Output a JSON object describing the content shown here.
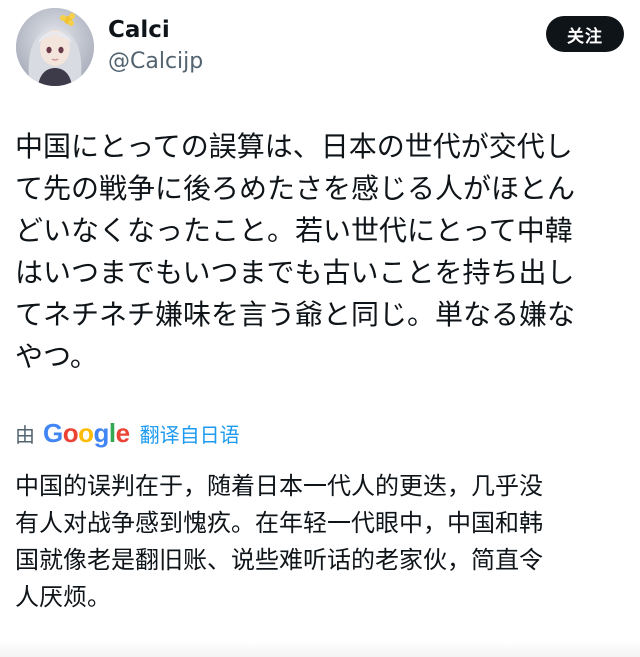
{
  "user": {
    "display_name": "Calci",
    "handle": "@Calcijp"
  },
  "actions": {
    "follow_label": "关注"
  },
  "tweet": {
    "text": "中国にとっての誤算は、日本の世代が交代し\nて先の戦争に後ろめたさを感じる人がほとん\nどいなくなったこと。若い世代にとって中韓\nはいつまでもいつまでも古いことを持ち出し\nてネチネチ嫌味を言う爺と同じ。単なる嫌な\nやつ。"
  },
  "translation": {
    "by_label": "由",
    "provider_logo_text": "Google",
    "from_label": "翻译自日语",
    "text": "中国的误判在于，随着日本一代人的更迭，几乎没\n有人对战争感到愧疚。在年轻一代眼中，中国和韩\n国就像老是翻旧账、说些难听话的老家伙，简直令\n人厌烦。"
  },
  "colors": {
    "text_primary": "#0f1419",
    "text_secondary": "#536471",
    "link_blue": "#1d9bf0",
    "button_bg": "#0f1419",
    "button_text": "#ffffff"
  },
  "icons": {
    "avatar": "user-avatar-image",
    "provider": "google-logo"
  }
}
